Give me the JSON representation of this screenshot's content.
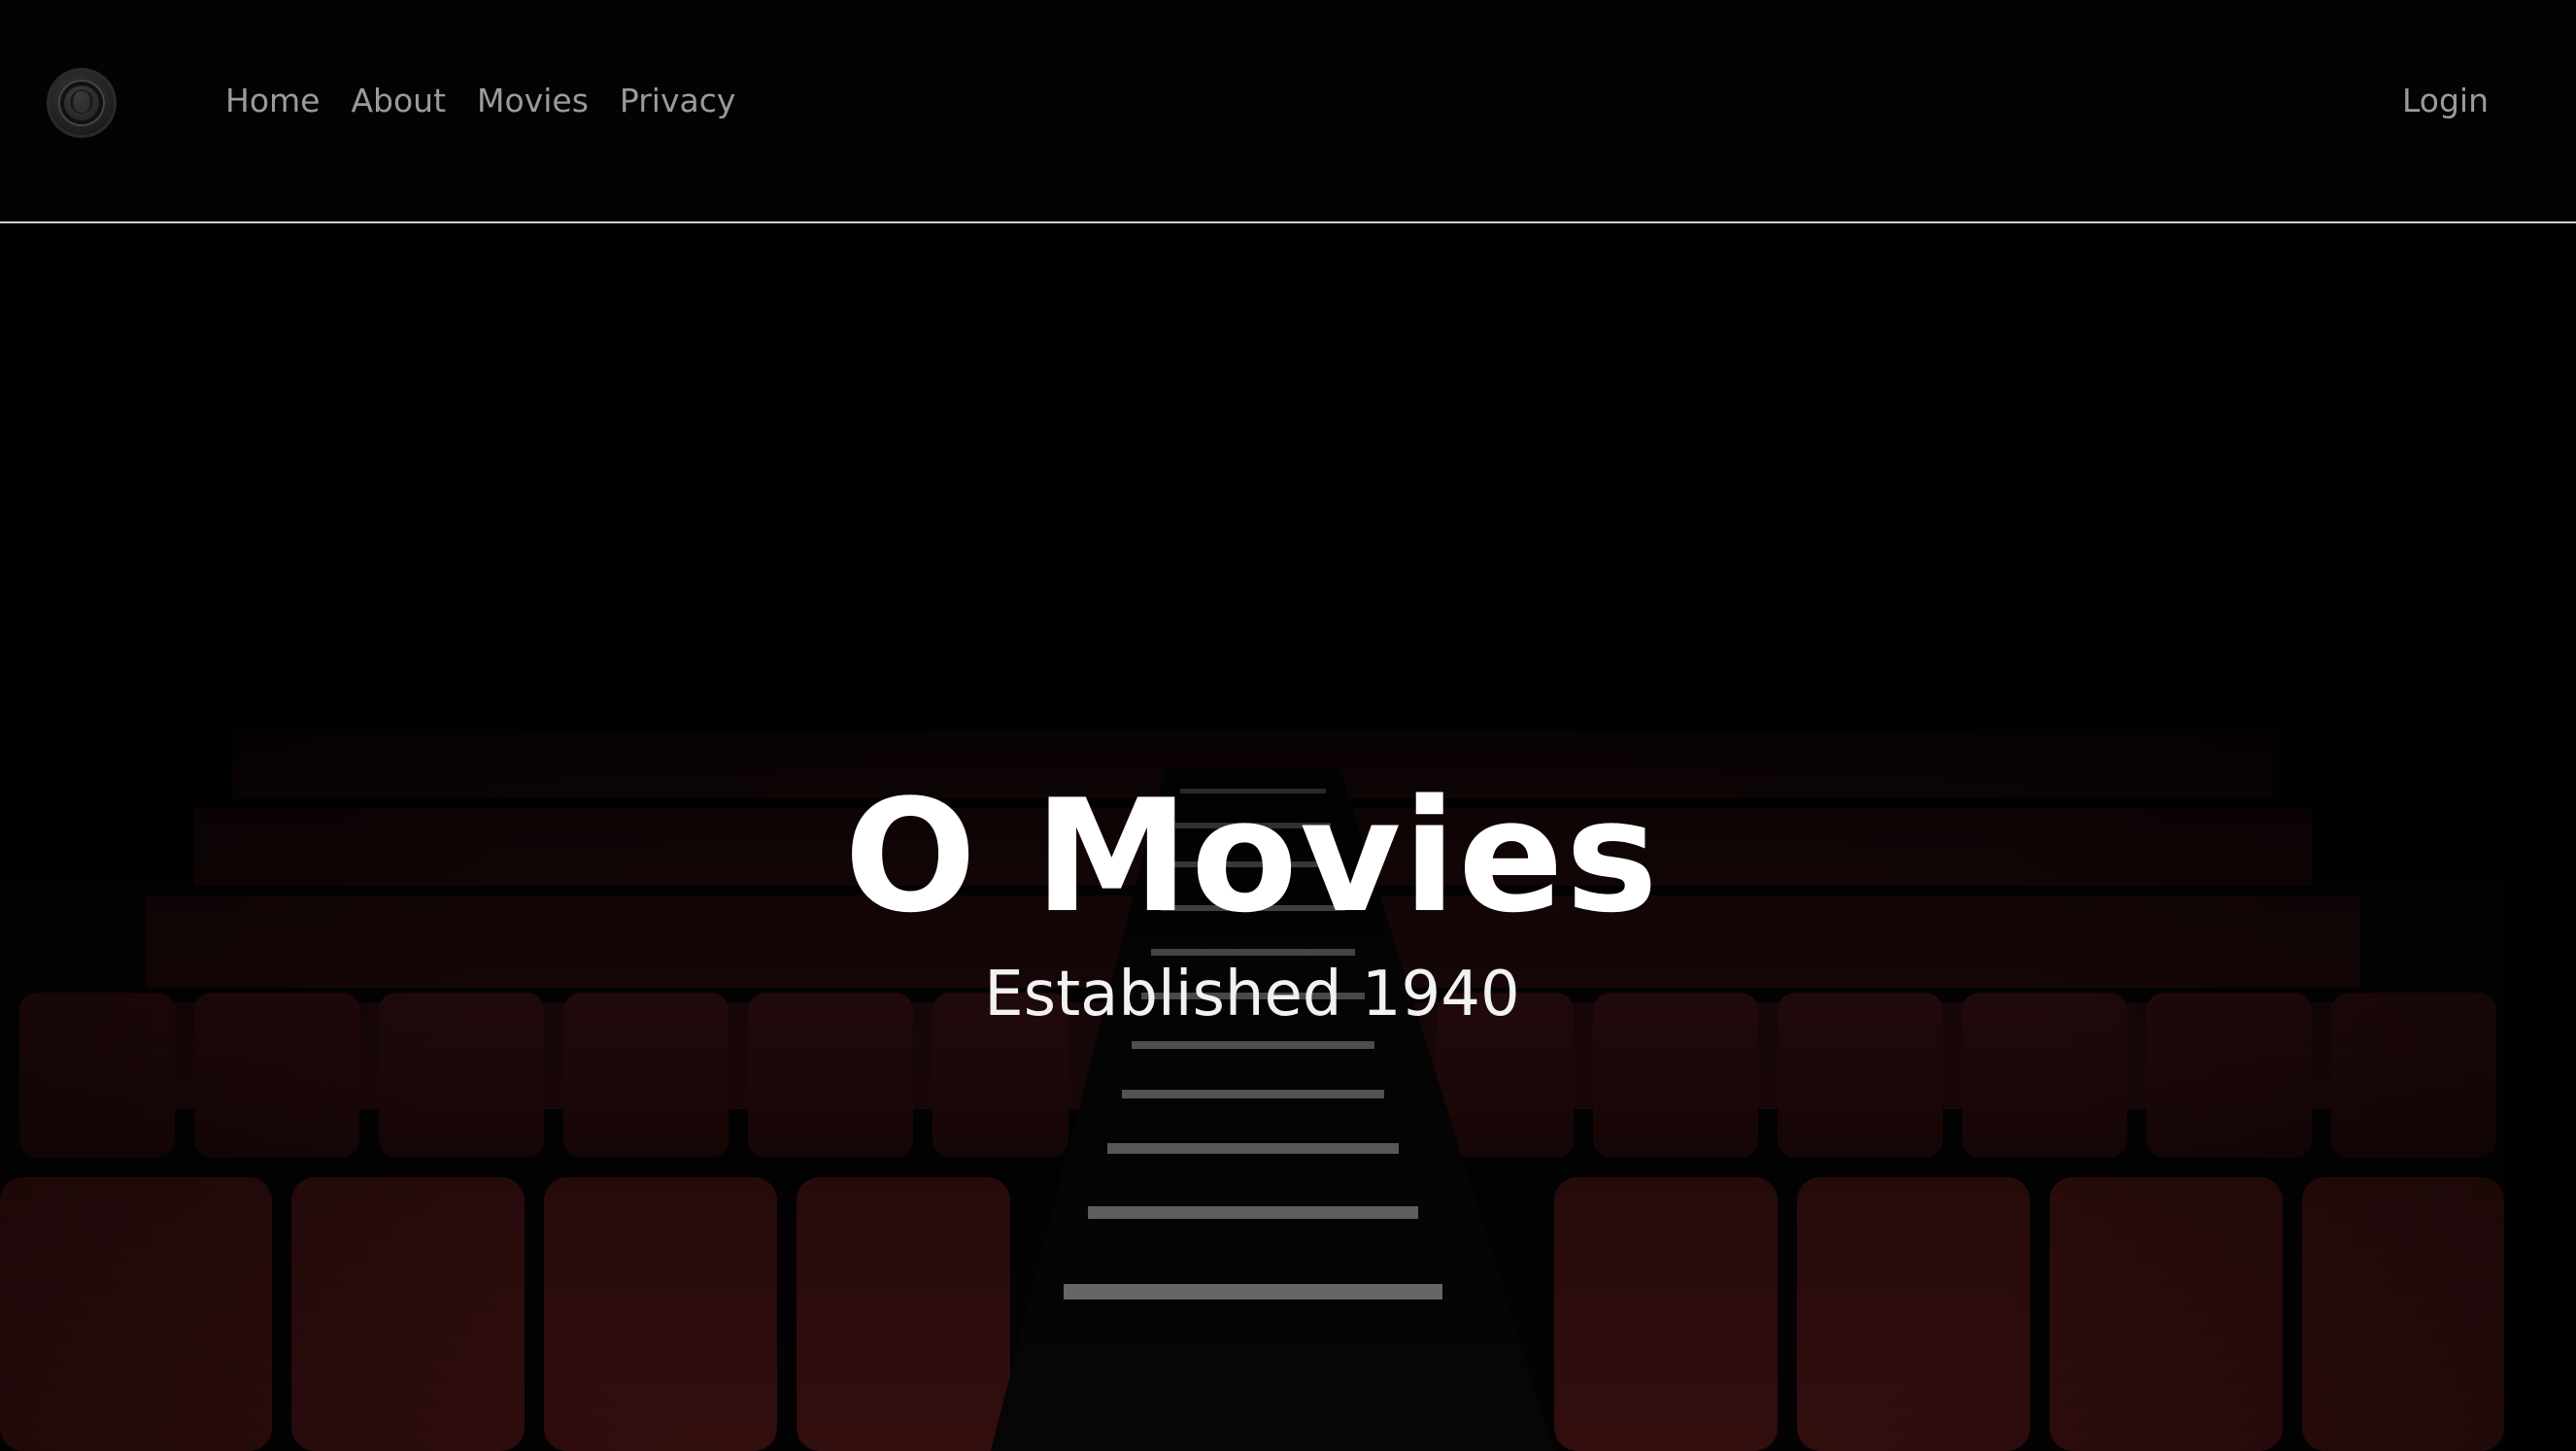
{
  "brand": {
    "logo_icon": "o-logo-icon"
  },
  "nav": {
    "items": [
      {
        "label": "Home"
      },
      {
        "label": "About"
      },
      {
        "label": "Movies"
      },
      {
        "label": "Privacy"
      }
    ],
    "login_label": "Login"
  },
  "hero": {
    "title": "O Movies",
    "subtitle": "Established 1940"
  },
  "colors": {
    "background": "#000000",
    "nav_text": "#9b9b9b",
    "divider": "#cfcfcf",
    "seat_red": "#3a0f10",
    "hero_text": "#ffffff"
  }
}
